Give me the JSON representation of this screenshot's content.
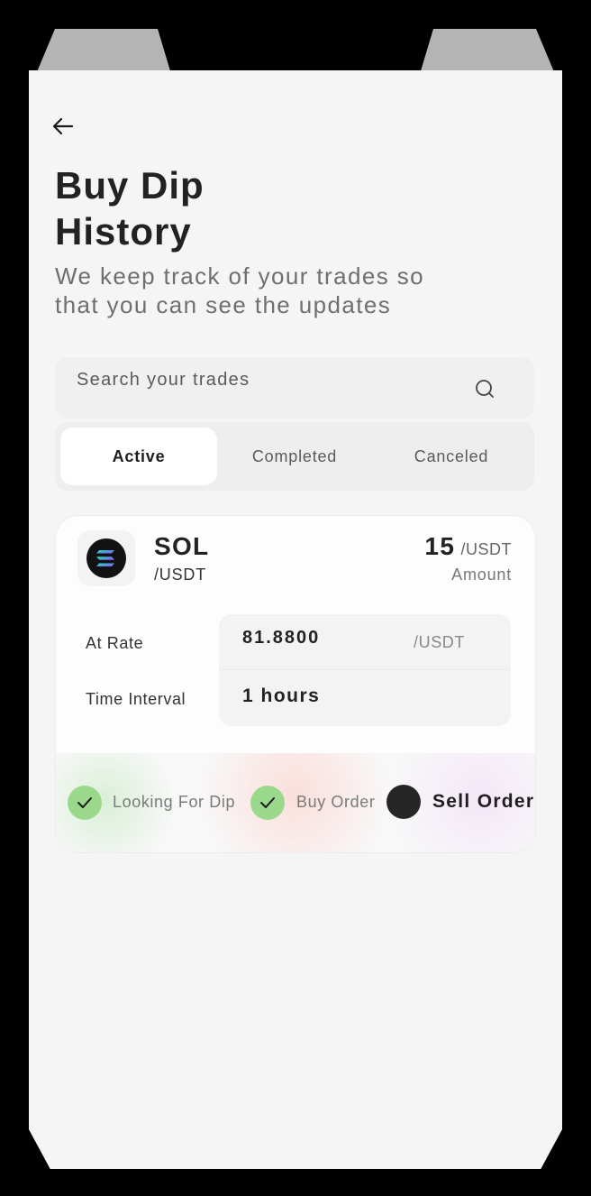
{
  "header": {
    "back_icon": "arrow-left-icon",
    "title": "Buy Dip\nHistory",
    "subtitle": "We keep track of your trades so\nthat you can see the updates"
  },
  "search": {
    "placeholder": "Search your trades",
    "value": "",
    "icon": "search-icon"
  },
  "tabs": [
    {
      "label": "Active",
      "active": true
    },
    {
      "label": "Completed",
      "active": false
    },
    {
      "label": "Canceled",
      "active": false
    }
  ],
  "trade": {
    "coin_icon": "solana-logo-icon",
    "symbol": "SOL",
    "quote": "/USDT",
    "amount": "15",
    "amount_unit": "/USDT",
    "amount_label": "Amount",
    "rate_label": "At Rate",
    "rate_value": "81.8800",
    "rate_unit": "/USDT",
    "interval_label": "Time Interval",
    "interval_value": "1 hours",
    "steps": [
      {
        "label": "Looking For Dip",
        "status": "done"
      },
      {
        "label": "Buy Order",
        "status": "done"
      },
      {
        "label": "Sell Order",
        "status": "current"
      }
    ]
  },
  "colors": {
    "background": "#000000",
    "screen": "#f5f5f5",
    "card": "#fdfdfd",
    "step_done": "#9ad98b",
    "step_current": "#262626",
    "text_primary": "#222222",
    "text_muted": "#6f6f6f"
  }
}
